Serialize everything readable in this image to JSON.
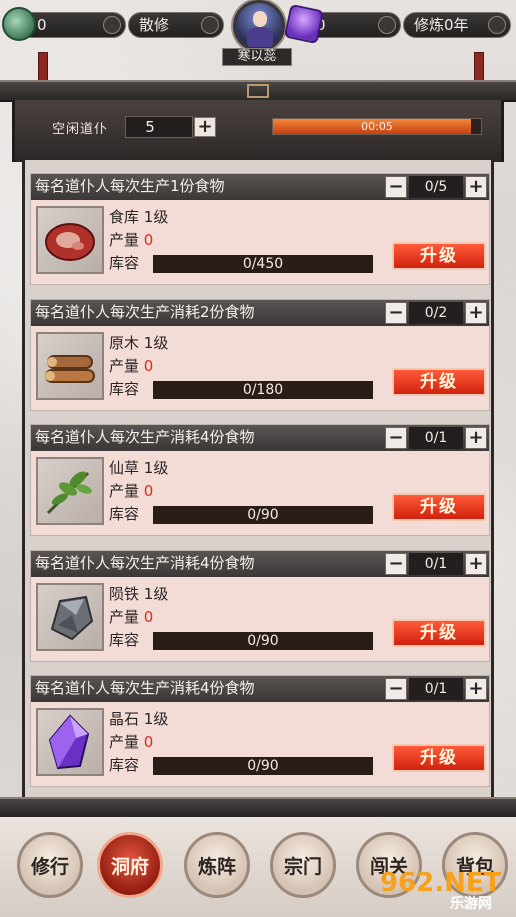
{
  "topbar": {
    "coins": "0",
    "role": "散修",
    "character_name": "寒以蕊",
    "gems": "0",
    "cultivation": "修炼0年"
  },
  "header": {
    "idle_label": "空闲道仆",
    "idle_count": "5",
    "plus": "+",
    "timer_text": "00:05",
    "timer_progress": 0.95
  },
  "cards": [
    {
      "title": "每名道仆人每次生产1份食物",
      "count": "0/5",
      "name": "食库",
      "level": "1级",
      "output_label": "产量",
      "output": "0",
      "storage_label": "库容",
      "storage": "0/450",
      "upgrade": "升级",
      "icon": "meat-icon"
    },
    {
      "title": "每名道仆人每次生产消耗2份食物",
      "count": "0/2",
      "name": "原木",
      "level": "1级",
      "output_label": "产量",
      "output": "0",
      "storage_label": "库容",
      "storage": "0/180",
      "upgrade": "升级",
      "icon": "wood-icon"
    },
    {
      "title": "每名道仆人每次生产消耗4份食物",
      "count": "0/1",
      "name": "仙草",
      "level": "1级",
      "output_label": "产量",
      "output": "0",
      "storage_label": "库容",
      "storage": "0/90",
      "upgrade": "升级",
      "icon": "herb-icon"
    },
    {
      "title": "每名道仆人每次生产消耗4份食物",
      "count": "0/1",
      "name": "陨铁",
      "level": "1级",
      "output_label": "产量",
      "output": "0",
      "storage_label": "库容",
      "storage": "0/90",
      "upgrade": "升级",
      "icon": "iron-icon"
    },
    {
      "title": "每名道仆人每次生产消耗4份食物",
      "count": "0/1",
      "name": "晶石",
      "level": "1级",
      "output_label": "产量",
      "output": "0",
      "storage_label": "库容",
      "storage": "0/90",
      "upgrade": "升级",
      "icon": "crystal-icon"
    }
  ],
  "controls": {
    "minus": "−",
    "plus": "+"
  },
  "nav": {
    "items": [
      {
        "label": "修行",
        "active": false
      },
      {
        "label": "洞府",
        "active": true
      },
      {
        "label": "炼阵",
        "active": false
      },
      {
        "label": "宗门",
        "active": false
      },
      {
        "label": "闯关",
        "active": false
      },
      {
        "label": "背包",
        "active": false
      }
    ]
  },
  "watermark": {
    "main": "962.NET",
    "sub": "乐游网"
  },
  "colors": {
    "accent_red": "#d0220d",
    "output_red": "#e02a1c",
    "timer_orange": "#f2873a",
    "panel_dark": "#3b3736"
  }
}
